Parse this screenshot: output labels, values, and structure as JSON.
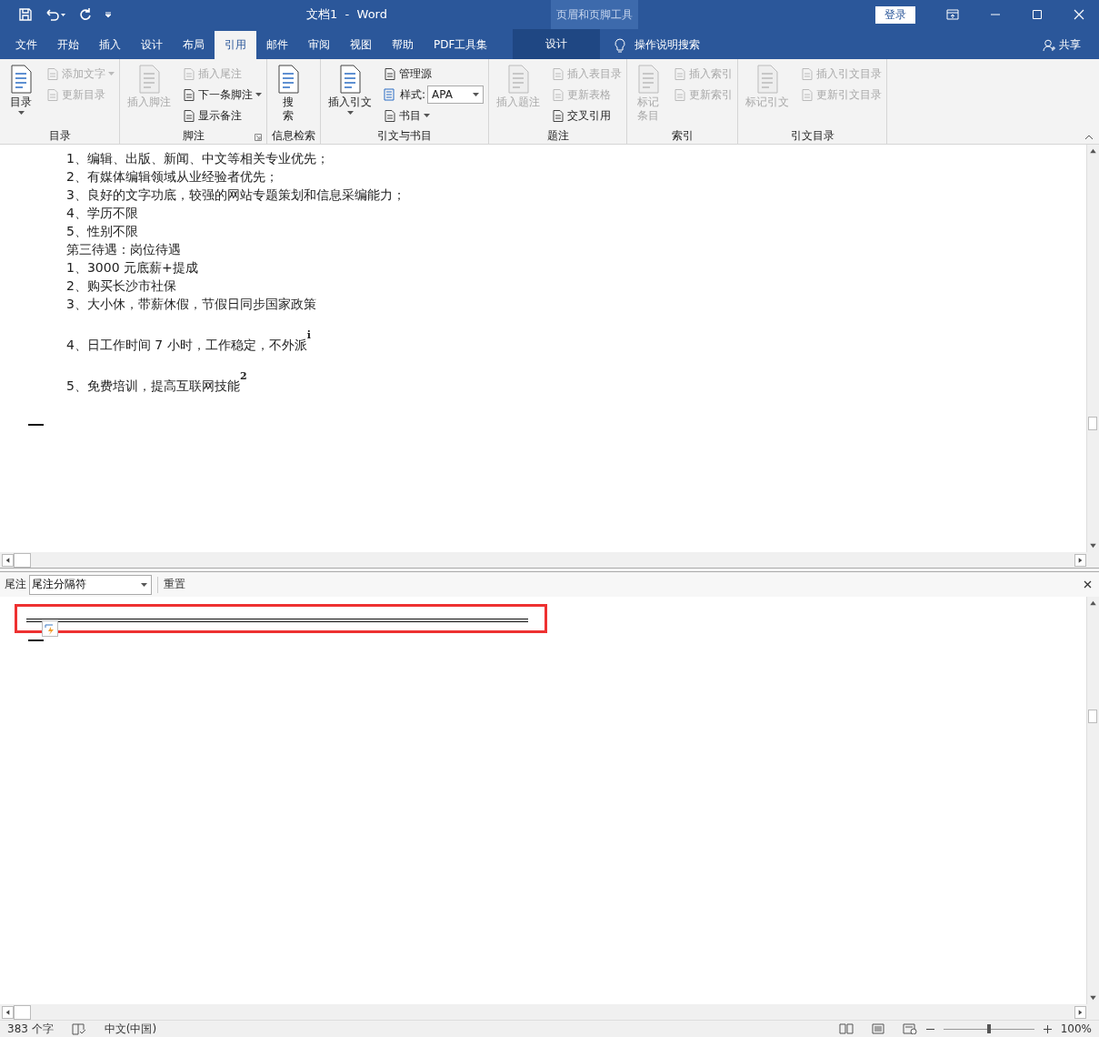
{
  "window": {
    "title": "文档1  -  Word",
    "login": "登录"
  },
  "contextual": {
    "title": "页眉和页脚工具",
    "tab": "设计"
  },
  "tabs": [
    {
      "label": "文件",
      "selected": false
    },
    {
      "label": "开始",
      "selected": false
    },
    {
      "label": "插入",
      "selected": false
    },
    {
      "label": "设计",
      "selected": false
    },
    {
      "label": "布局",
      "selected": false
    },
    {
      "label": "引用",
      "selected": true
    },
    {
      "label": "邮件",
      "selected": false
    },
    {
      "label": "审阅",
      "selected": false
    },
    {
      "label": "视图",
      "selected": false
    },
    {
      "label": "帮助",
      "selected": false
    },
    {
      "label": "PDF工具集",
      "selected": false
    }
  ],
  "tell_me": "操作说明搜索",
  "share": "共享",
  "ribbon": [
    {
      "label": "目录",
      "launcher": false,
      "items": [
        {
          "kind": "large",
          "label": "目录",
          "disabled": false,
          "dropdown": true
        },
        {
          "kind": "small",
          "label": "添加文字",
          "disabled": true,
          "dropdown": true
        },
        {
          "kind": "small",
          "label": "更新目录",
          "disabled": true,
          "dropdown": false
        }
      ]
    },
    {
      "label": "脚注",
      "launcher": true,
      "items": [
        {
          "kind": "large",
          "label": "插入脚注",
          "disabled": true,
          "dropdown": false
        },
        {
          "kind": "small",
          "label": "插入尾注",
          "disabled": true,
          "dropdown": false
        },
        {
          "kind": "small",
          "label": "下一条脚注",
          "disabled": false,
          "dropdown": true
        },
        {
          "kind": "small",
          "label": "显示备注",
          "disabled": false,
          "dropdown": false
        }
      ]
    },
    {
      "label": "信息检索",
      "launcher": false,
      "items": [
        {
          "kind": "stacked",
          "label": "搜索",
          "disabled": false,
          "dropdown": false
        }
      ]
    },
    {
      "label": "引文与书目",
      "launcher": false,
      "items": [
        {
          "kind": "large",
          "label": "插入引文",
          "disabled": false,
          "dropdown": true
        },
        {
          "kind": "small",
          "label": "管理源",
          "disabled": false,
          "dropdown": false
        },
        {
          "kind": "combo",
          "label": "样式:",
          "value": "APA",
          "disabled": false,
          "dropdown": true
        },
        {
          "kind": "small",
          "label": "书目",
          "disabled": false,
          "dropdown": true
        }
      ]
    },
    {
      "label": "题注",
      "launcher": false,
      "items": [
        {
          "kind": "large",
          "label": "插入题注",
          "disabled": true,
          "dropdown": false
        },
        {
          "kind": "small",
          "label": "插入表目录",
          "disabled": true,
          "dropdown": false
        },
        {
          "kind": "small",
          "label": "更新表格",
          "disabled": true,
          "dropdown": false
        },
        {
          "kind": "small",
          "label": "交叉引用",
          "disabled": false,
          "dropdown": false
        }
      ]
    },
    {
      "label": "索引",
      "launcher": false,
      "items": [
        {
          "kind": "stacked",
          "label": "标记条目",
          "disabled": true,
          "dropdown": false
        },
        {
          "kind": "small",
          "label": "插入索引",
          "disabled": true,
          "dropdown": false
        },
        {
          "kind": "small",
          "label": "更新索引",
          "disabled": true,
          "dropdown": false
        }
      ]
    },
    {
      "label": "引文目录",
      "launcher": false,
      "items": [
        {
          "kind": "large",
          "label": "标记引文",
          "disabled": true,
          "dropdown": false
        },
        {
          "kind": "small",
          "label": "插入引文目录",
          "disabled": true,
          "dropdown": false
        },
        {
          "kind": "small",
          "label": "更新引文目录",
          "disabled": true,
          "dropdown": false
        }
      ]
    }
  ],
  "document": {
    "lines": [
      "1、编辑、出版、新闻、中文等相关专业优先；",
      "2、有媒体编辑领域从业经验者优先；",
      "3、良好的文字功底，较强的网站专题策划和信息采编能力；",
      "4、学历不限",
      "5、性别不限",
      "第三待遇：岗位待遇",
      "1、3000 元底薪+提成",
      "2、购买长沙市社保",
      "3、大小休，带薪休假，节假日同步国家政策",
      "4、日工作时间 7 小时，工作稳定，不外派$^{i}$",
      "5、免费培训，提高互联网技能$^{2}$"
    ]
  },
  "endnote_pane": {
    "label": "尾注",
    "select": "尾注分隔符",
    "reset": "重置"
  },
  "status_bar": {
    "words": "383 个字",
    "language": "中文(中国)",
    "zoom": "100%",
    "zoom_slider": {
      "level": 0.5
    }
  }
}
